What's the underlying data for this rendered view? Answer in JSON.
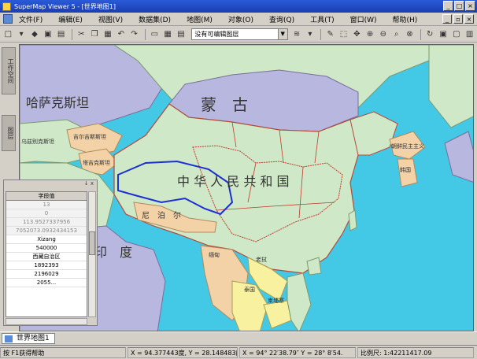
{
  "window": {
    "title": "SuperMap Viewer 5 - [世界地图1]"
  },
  "menu": [
    "文件(F)",
    "编辑(E)",
    "视图(V)",
    "数据集(D)",
    "地图(M)",
    "对象(O)",
    "查询(Q)",
    "工具(T)",
    "窗口(W)",
    "帮助(H)"
  ],
  "toolbar": {
    "layer_select": "没有可编辑图层"
  },
  "side_tabs": [
    "工作空间",
    "图层"
  ],
  "map": {
    "labels": {
      "kazakhstan": "哈萨克斯坦",
      "mongolia": "蒙　古",
      "china": "中 华 人 民 共 和 国",
      "india": "印　度",
      "kyrgyzstan": "吉尔吉斯斯坦",
      "tajikistan": "塔吉克斯坦",
      "uzbekistan": "乌兹别克斯坦",
      "north_korea": "朝鲜民主主义",
      "south_korea": "韩国",
      "nepal": "尼　泊　尔",
      "myanmar": "缅甸",
      "laos": "老挝",
      "thailand": "泰国",
      "cambodia": "柬埔寨"
    }
  },
  "attribute_panel": {
    "pin": "↓ x",
    "column_header": "字段值",
    "values": [
      "13",
      "0",
      "113.9527337956",
      "7052073.0932434153",
      "Xizang",
      "540000",
      "西藏自治区",
      "1892393",
      "2196029",
      "2055..."
    ]
  },
  "document_tab": {
    "label": "世界地图1"
  },
  "status": {
    "help": "按 F1获得帮助",
    "coord_decimal": "X = 94.377443度, Y = 28.148483度",
    "coord_dms": "X = 94° 22′38.79″ Y = 28° 8′54.",
    "scale": "比例尺: 1:42211417.09"
  }
}
